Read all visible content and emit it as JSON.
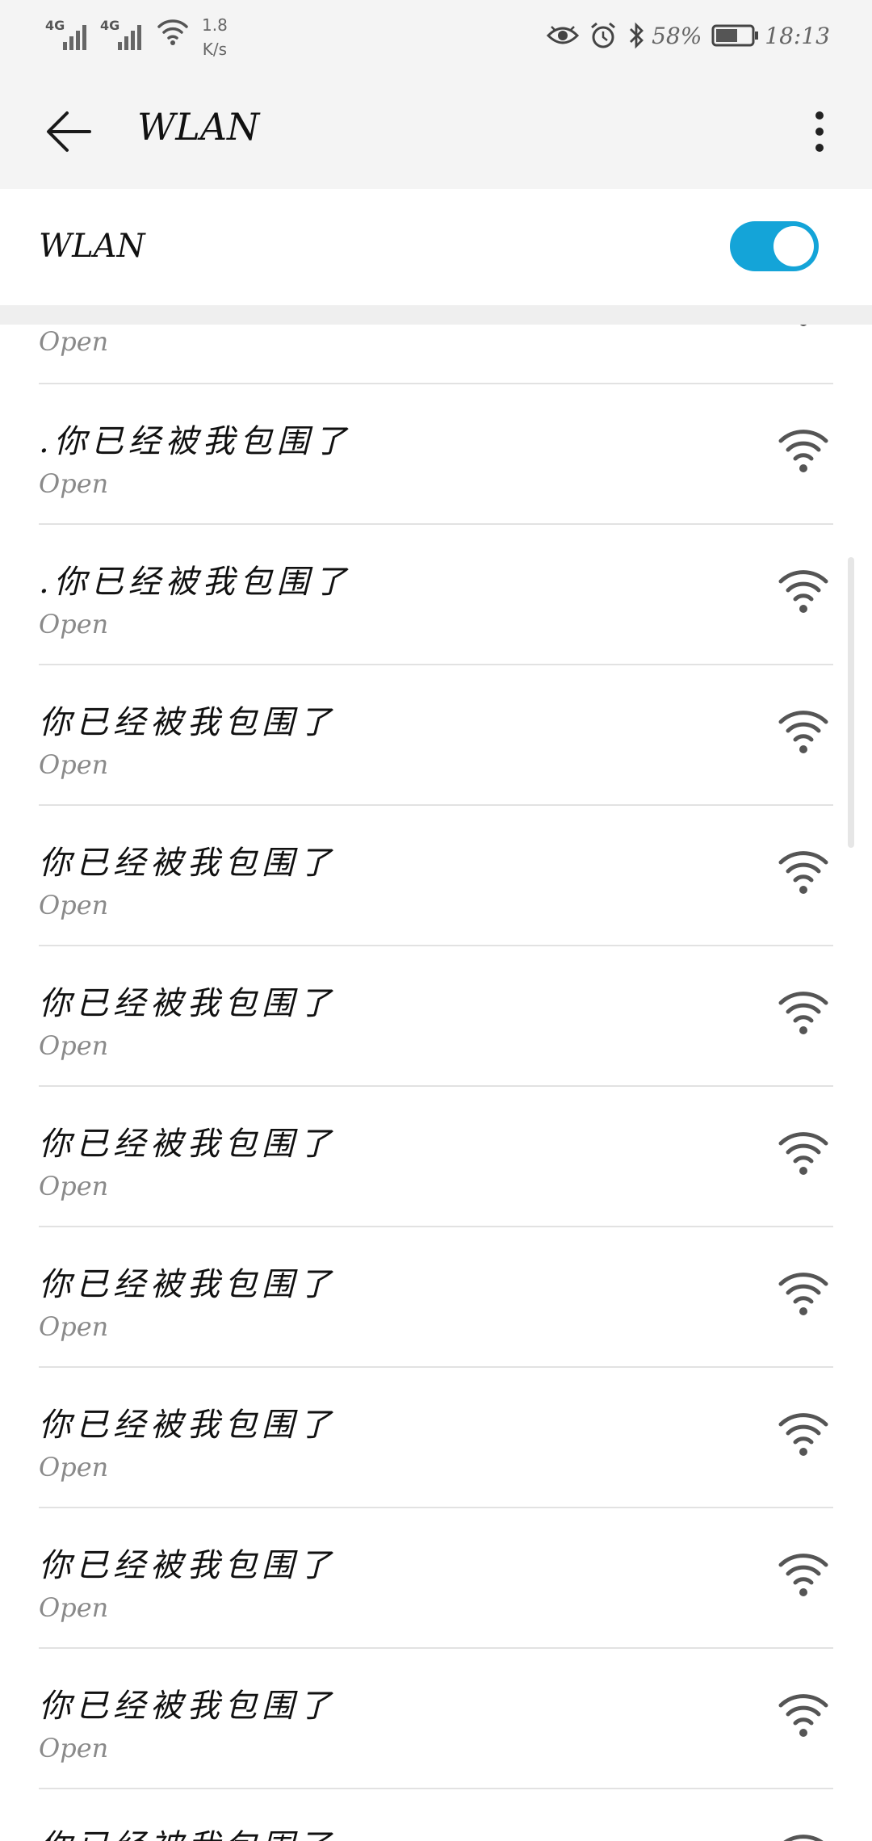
{
  "status_bar": {
    "network_1": "4G",
    "network_2": "4G",
    "speed_value": "1.8",
    "speed_unit": "K/s",
    "battery_percent": "58%",
    "time": "18:13"
  },
  "app_bar": {
    "title": "WLAN"
  },
  "wlan_toggle": {
    "label": "WLAN",
    "state": "on",
    "accent_color": "#14a4d8"
  },
  "networks": [
    {
      "name": "",
      "security": "Open"
    },
    {
      "name": ".你已经被我包围了",
      "security": "Open"
    },
    {
      "name": ".你已经被我包围了",
      "security": "Open"
    },
    {
      "name": "你已经被我包围了",
      "security": "Open"
    },
    {
      "name": "你已经被我包围了",
      "security": "Open"
    },
    {
      "name": "你已经被我包围了",
      "security": "Open"
    },
    {
      "name": "你已经被我包围了",
      "security": "Open"
    },
    {
      "name": "你已经被我包围了",
      "security": "Open"
    },
    {
      "name": "你已经被我包围了",
      "security": "Open"
    },
    {
      "name": "你已经被我包围了",
      "security": "Open"
    },
    {
      "name": "你已经被我包围了",
      "security": "Open"
    },
    {
      "name": "你已经被我包围了",
      "security": ""
    }
  ]
}
